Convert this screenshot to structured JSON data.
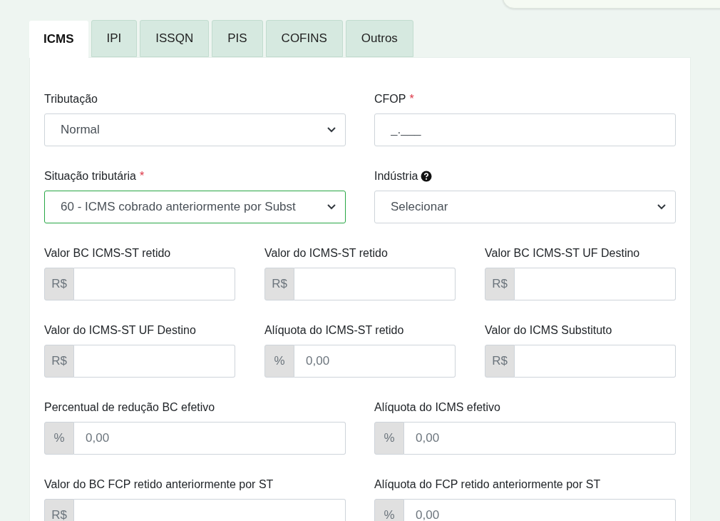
{
  "tabs": [
    {
      "label": "ICMS",
      "selected": true
    },
    {
      "label": "IPI",
      "selected": false
    },
    {
      "label": "ISSQN",
      "selected": false
    },
    {
      "label": "PIS",
      "selected": false
    },
    {
      "label": "COFINS",
      "selected": false
    },
    {
      "label": "Outros",
      "selected": false
    }
  ],
  "rows": [
    {
      "fields": [
        {
          "kind": "select",
          "label": "Tributação",
          "help": false,
          "value": "Normal",
          "focused": false
        },
        {
          "kind": "text",
          "label": "CFOP",
          "required_mark": "*",
          "help": false,
          "value": "_.___",
          "focused": false
        }
      ]
    },
    {
      "fields": [
        {
          "kind": "select",
          "label": "Situação tributária",
          "required_mark": "*",
          "help": false,
          "value": "60 - ICMS cobrado anteriormente por Subst",
          "focused": true
        },
        {
          "kind": "select",
          "label": "Indústria",
          "help": true,
          "value": "Selecionar",
          "focused": false
        }
      ]
    },
    {
      "fields": [
        {
          "kind": "addon",
          "label": "Valor BC ICMS-ST retido",
          "addon": "R$",
          "focused": false
        },
        {
          "kind": "addon",
          "label": "Valor do ICMS-ST retido",
          "addon": "R$",
          "focused": false
        },
        {
          "kind": "addon",
          "label": "Valor BC ICMS-ST UF Destino",
          "addon": "R$",
          "focused": false
        }
      ]
    },
    {
      "fields": [
        {
          "kind": "addon",
          "label": "Valor do ICMS-ST UF Destino",
          "addon": "R$",
          "focused": false
        },
        {
          "kind": "addon",
          "label": "Alíquota do ICMS-ST retido",
          "addon": "%",
          "placeholder": "0,00",
          "focused": false
        },
        {
          "kind": "addon",
          "label": "Valor do ICMS Substituto",
          "addon": "R$",
          "focused": false
        }
      ]
    },
    {
      "fields": [
        {
          "kind": "addon",
          "label": "Percentual de redução BC efetivo",
          "addon": "%",
          "placeholder": "0,00",
          "focused": false
        },
        {
          "kind": "addon",
          "label": "Alíquota do ICMS efetivo",
          "addon": "%",
          "placeholder": "0,00",
          "focused": false
        }
      ]
    },
    {
      "fields": [
        {
          "kind": "addon",
          "label": "Valor do BC FCP retido anteriormente por ST",
          "addon": "R$",
          "focused": false
        },
        {
          "kind": "addon",
          "label": "Alíquota do FCP retido anteriormente por ST",
          "addon": "%",
          "placeholder": "0,00",
          "focused": false
        }
      ]
    }
  ]
}
